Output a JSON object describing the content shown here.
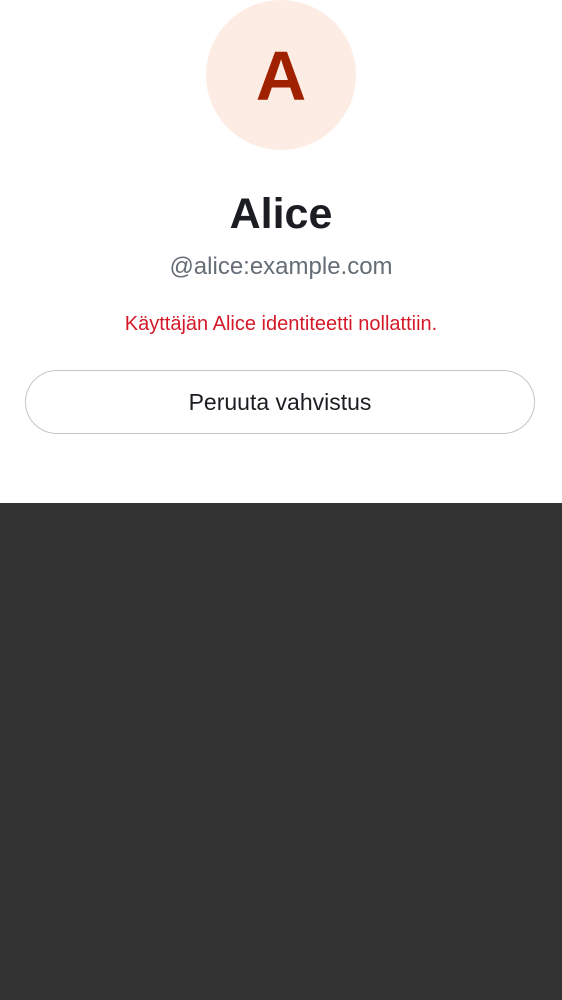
{
  "profile": {
    "avatar_letter": "A",
    "display_name": "Alice",
    "user_id": "@alice:example.com"
  },
  "warning": {
    "text": "Käyttäjän Alice identiteetti nollattiin."
  },
  "actions": {
    "cancel_verification_label": "Peruuta vahvistus"
  },
  "colors": {
    "avatar_bg": "#fdece3",
    "avatar_letter": "#a02100",
    "warning": "#d51928",
    "backdrop": "#333333"
  }
}
